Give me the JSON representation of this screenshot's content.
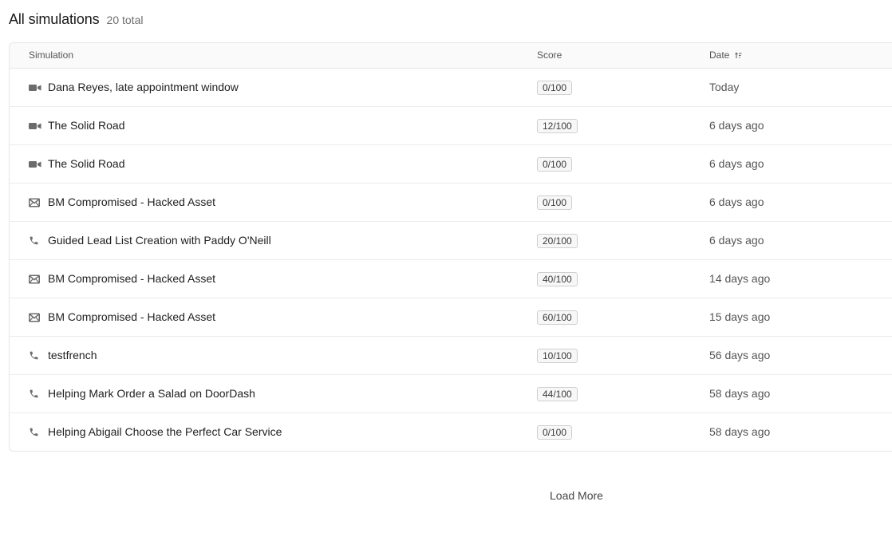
{
  "header": {
    "title": "All simulations",
    "total": "20 total"
  },
  "table": {
    "columns": {
      "simulation": "Simulation",
      "score": "Score",
      "date": "Date"
    },
    "rows": [
      {
        "icon": "video-icon",
        "name": "Dana Reyes, late appointment window",
        "score": "0/100",
        "date": "Today"
      },
      {
        "icon": "video-icon",
        "name": "The Solid Road",
        "score": "12/100",
        "date": "6 days ago"
      },
      {
        "icon": "video-icon",
        "name": "The Solid Road",
        "score": "0/100",
        "date": "6 days ago"
      },
      {
        "icon": "mail-icon",
        "name": "BM Compromised - Hacked Asset",
        "score": "0/100",
        "date": "6 days ago"
      },
      {
        "icon": "phone-icon",
        "name": "Guided Lead List Creation with Paddy O'Neill",
        "score": "20/100",
        "date": "6 days ago"
      },
      {
        "icon": "mail-icon",
        "name": "BM Compromised - Hacked Asset",
        "score": "40/100",
        "date": "14 days ago"
      },
      {
        "icon": "mail-icon",
        "name": "BM Compromised - Hacked Asset",
        "score": "60/100",
        "date": "15 days ago"
      },
      {
        "icon": "phone-icon",
        "name": "testfrench",
        "score": "10/100",
        "date": "56 days ago"
      },
      {
        "icon": "phone-icon",
        "name": "Helping Mark Order a Salad on DoorDash",
        "score": "44/100",
        "date": "58 days ago"
      },
      {
        "icon": "phone-icon",
        "name": "Helping Abigail Choose the Perfect Car Service",
        "score": "0/100",
        "date": "58 days ago"
      }
    ]
  },
  "footer": {
    "load_more_label": "Load More"
  },
  "colors": {
    "icon": "#6b6b6b",
    "border": "#e6e6e6",
    "header_bg": "#fafafa"
  }
}
